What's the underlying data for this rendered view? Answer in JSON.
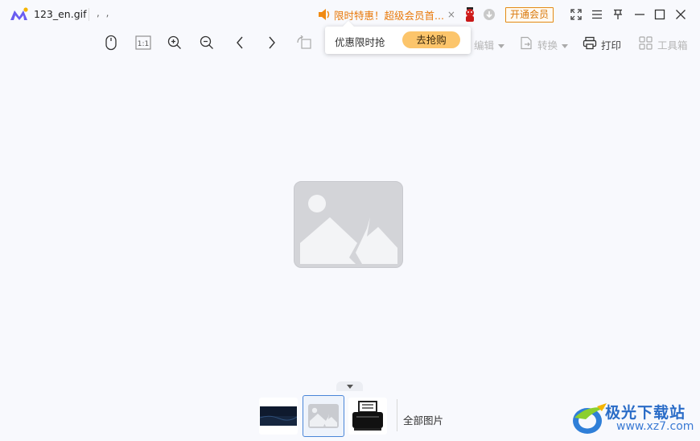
{
  "titlebar": {
    "filename": "123_en.gif",
    "meta": ", ,",
    "promo_text": "限时特惠！超级会员首...",
    "promo_close": "×",
    "vip_button": "开通会员"
  },
  "toolbar": {
    "edit_label": "编辑",
    "convert_label": "转换",
    "print_label": "打印",
    "toolbox_label": "工具箱",
    "actual_size_label": "1:1"
  },
  "popup": {
    "text": "优惠限时抢",
    "button": "去抢购"
  },
  "thumbnails": {
    "all_images_label": "全部图片"
  },
  "watermark": {
    "title": "极光下载站",
    "url": "www.xz7.com"
  },
  "colors": {
    "accent_orange": "#e8790a",
    "popup_button": "#fcc56b",
    "selection_blue": "#4a86d8",
    "watermark_blue": "#2a6cc7"
  }
}
